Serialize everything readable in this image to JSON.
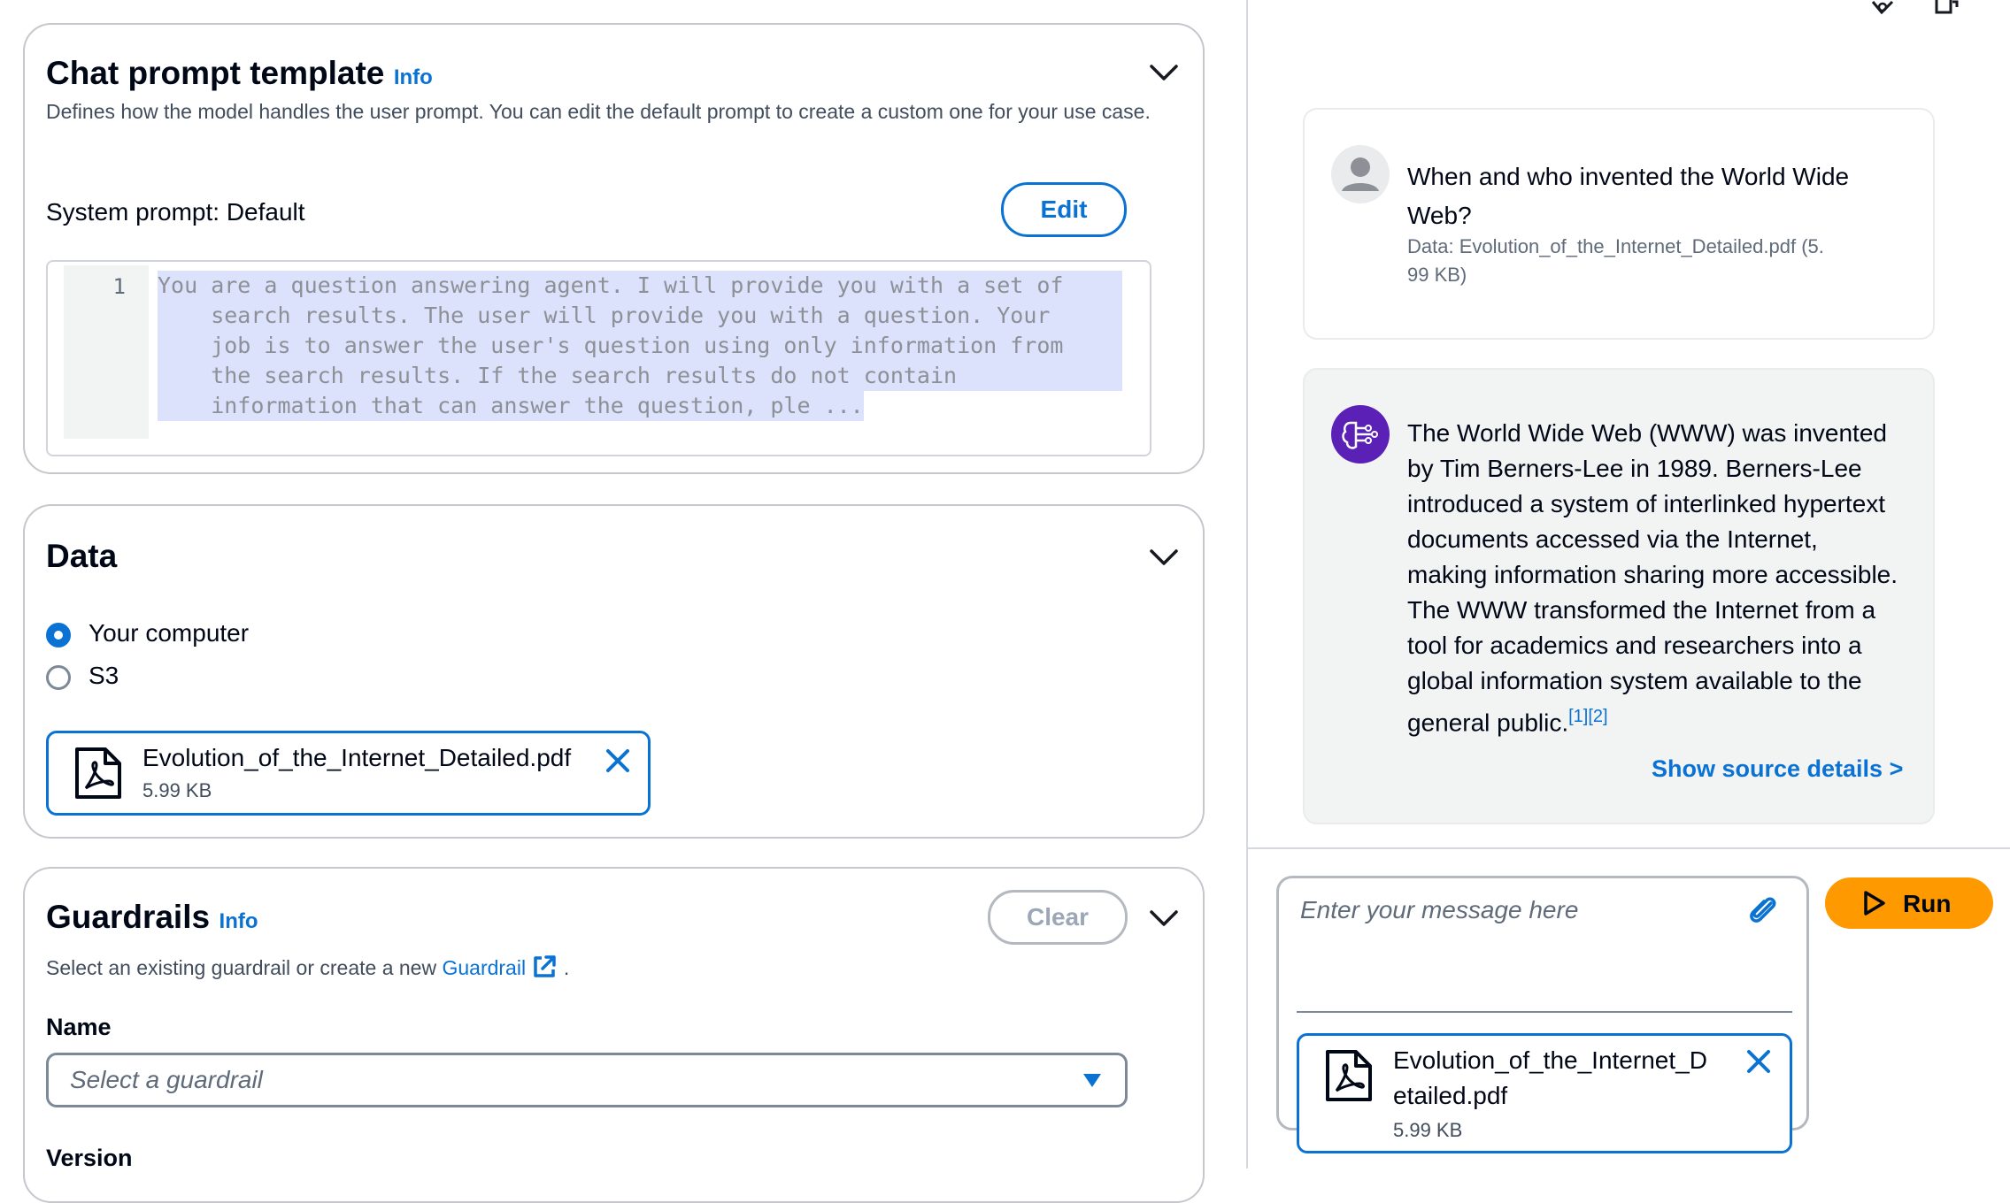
{
  "chat_prompt": {
    "title": "Chat prompt template",
    "info": "Info",
    "description": "Defines how the model handles the user prompt. You can edit the default prompt to create a custom one for your use case.",
    "system_prompt_label": "System prompt: Default",
    "edit_label": "Edit",
    "line_number": "1",
    "code_lines": [
      "You are a question answering agent. I will provide you with a set of",
      "    search results. The user will provide you with a question. Your",
      "    job is to answer the user's question using only information from",
      "    the search results. If the search results do not contain",
      "    information that can answer the question, ple ..."
    ]
  },
  "data_section": {
    "title": "Data",
    "options": [
      "Your computer",
      "S3"
    ],
    "selected": "Your computer",
    "file": {
      "name": "Evolution_of_the_Internet_Detailed.pdf",
      "size": "5.99 KB"
    }
  },
  "guardrails": {
    "title": "Guardrails",
    "info": "Info",
    "clear_label": "Clear",
    "description_prefix": "Select an existing guardrail or create a new",
    "link": "Guardrail",
    "description_suffix": ".",
    "name_label": "Name",
    "select_placeholder": "Select a guardrail",
    "version_label": "Version"
  },
  "chat": {
    "user_message": "When and who invented the World Wide Web?",
    "user_data_line1": "Data: Evolution_of_the_Internet_Detailed.pdf (5.",
    "user_data_line2": "99 KB)",
    "assistant_message": "The World Wide Web (WWW) was invented by Tim Berners-Lee in 1989. Berners-Lee introduced a system of interlinked hypertext documents accessed via the Internet, making information sharing more accessible. The WWW transformed the Internet from a tool for academics and researchers into a global information system available to the general public.",
    "citations": "[1][2]",
    "show_source": "Show source details >",
    "input_placeholder": "Enter your message here",
    "run_label": "Run",
    "attached_file": {
      "name_line1": "Evolution_of_the_Internet_D",
      "name_line2": "etailed.pdf",
      "size": "5.99 KB"
    }
  },
  "colors": {
    "accent": "#0972d3",
    "run": "#ff9900",
    "assistant_avatar": "#5b21b6",
    "assistant_bg": "#f2f3f3"
  },
  "icons": [
    "chevron-down-icon",
    "pdf-file-icon",
    "close-icon",
    "external-link-icon",
    "caret-down-icon",
    "user-avatar-icon",
    "ai-brain-icon",
    "paperclip-icon",
    "play-icon",
    "toolbar-icon-a",
    "toolbar-icon-b"
  ]
}
